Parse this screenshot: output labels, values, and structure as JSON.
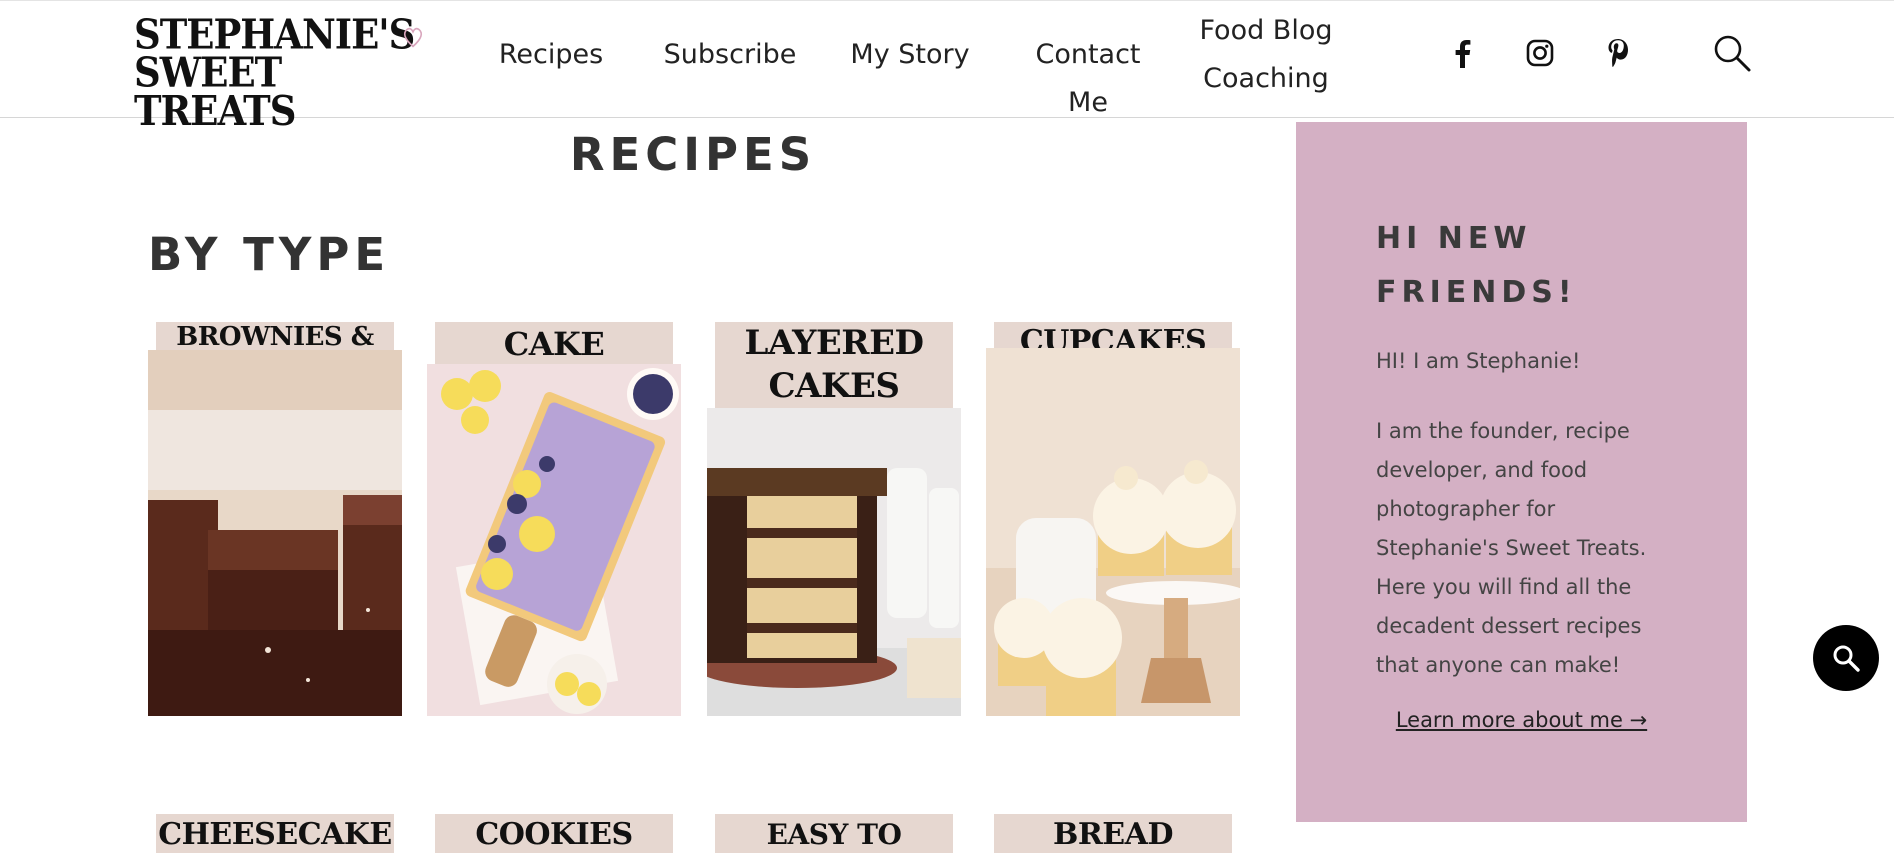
{
  "logo": {
    "line1": "STEPHANIE'S",
    "line2": "SWEET TREATS"
  },
  "nav": [
    {
      "label": "Recipes"
    },
    {
      "label": "Subscribe"
    },
    {
      "label": "My Story"
    },
    {
      "label": "Contact Me"
    },
    {
      "label_line1": "Food Blog",
      "label_line2": "Coaching"
    }
  ],
  "social": [
    "facebook-icon",
    "instagram-icon",
    "pinterest-icon"
  ],
  "main": {
    "title": "RECIPES",
    "section": "BY TYPE",
    "cards": [
      {
        "label": "BROWNIES & BARS"
      },
      {
        "label": "CAKE"
      },
      {
        "label_line1": "LAYERED",
        "label_line2": "CAKES"
      },
      {
        "label": "CUPCAKES"
      },
      {
        "label": "CHEESECAKE"
      },
      {
        "label": "COOKIES"
      },
      {
        "label": "EASY TO MAKE"
      },
      {
        "label": "BREAD ROLLS"
      }
    ]
  },
  "sidebar": {
    "heading": "HI NEW FRIENDS!",
    "greeting": "HI! I am Stephanie!",
    "paragraph": "I am the founder, recipe developer, and food photographer for Stephanie's Sweet Treats. Here you will find all the decadent dessert recipes that anyone can make!",
    "link": "Learn more about me →"
  },
  "colors": {
    "sidebar_bg": "#d4b0c4",
    "label_bg": "#e6d7d0",
    "text": "#333333"
  }
}
